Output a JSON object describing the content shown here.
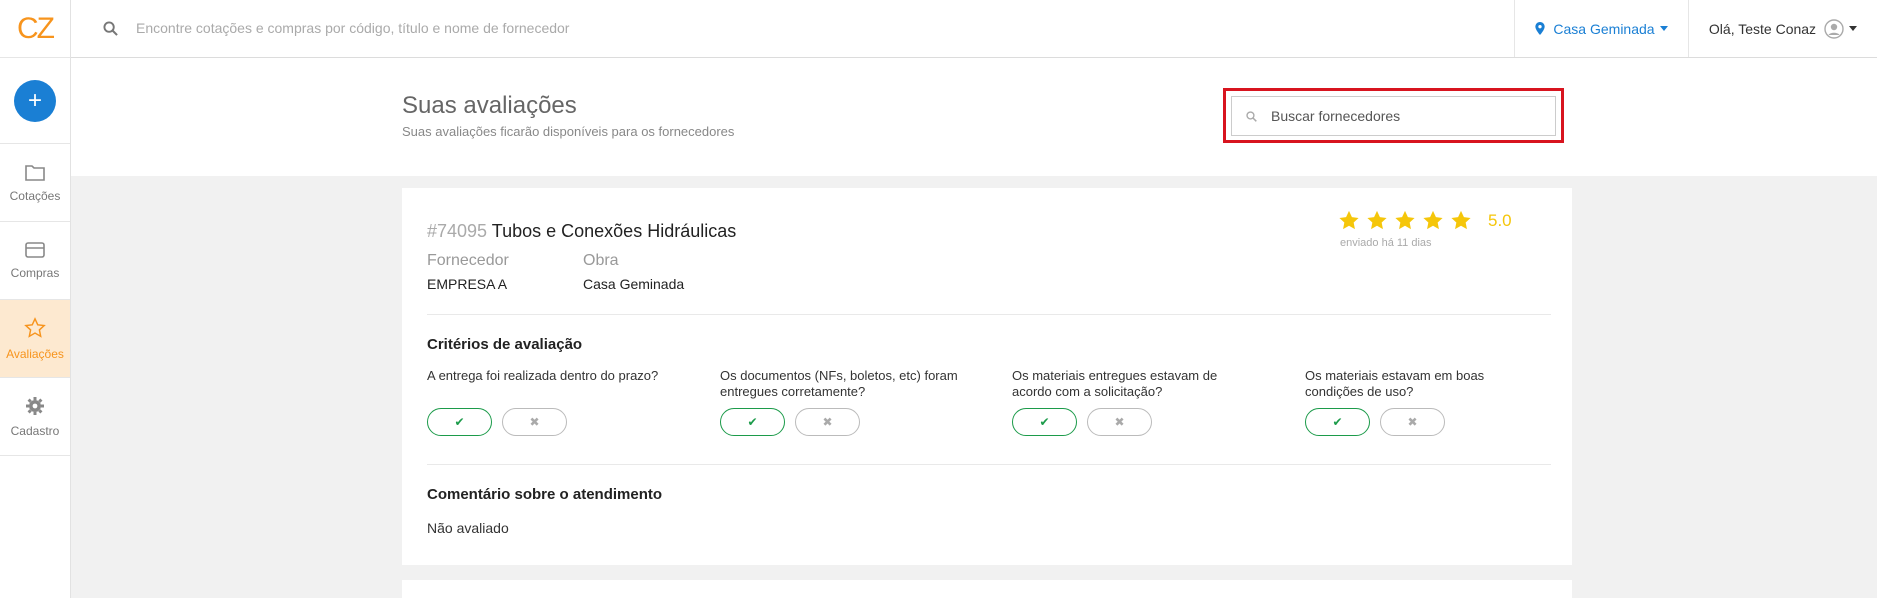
{
  "logo": {
    "text": "CZ"
  },
  "sidebar": {
    "add_label": "+",
    "items": [
      {
        "label": "Cotações",
        "icon": "folder-icon"
      },
      {
        "label": "Compras",
        "icon": "card-icon"
      },
      {
        "label": "Avaliações",
        "icon": "star-icon"
      },
      {
        "label": "Cadastro",
        "icon": "gear-icon"
      }
    ]
  },
  "topbar": {
    "search_placeholder": "Encontre cotações e compras por código, título e nome de fornecedor",
    "obra": "Casa Geminada",
    "greeting": "Olá, Teste Conaz"
  },
  "page": {
    "title": "Suas avaliações",
    "subtitle": "Suas avaliações ficarão disponíveis para os fornecedores",
    "search_placeholder": "Buscar fornecedores"
  },
  "review": {
    "number": "#74095",
    "title": "Tubos e Conexões Hidráulicas",
    "fornecedor_label": "Fornecedor",
    "fornecedor": "EMPRESA A",
    "obra_label": "Obra",
    "obra": "Casa Geminada",
    "score": "5.0",
    "stars": 5,
    "sent": "enviado há 11 dias",
    "criteria_title": "Critérios de avaliação",
    "criteria": [
      {
        "question": "A entrega foi realizada dentro do prazo?"
      },
      {
        "question": "Os documentos (NFs, boletos, etc) foram entregues corretamente?"
      },
      {
        "question": "Os materiais entregues estavam de acordo com a solicitação?"
      },
      {
        "question": "Os materiais estavam em boas condições de uso?"
      }
    ],
    "yes_symbol": "✔",
    "no_symbol": "✖",
    "comment_title": "Comentário sobre o atendimento",
    "comment": "Não avaliado"
  },
  "colors": {
    "accent": "#f7941d",
    "primary": "#1a7fd4",
    "success": "#1c9b4a",
    "star": "#f5c60a",
    "highlight": "#d8141f"
  }
}
